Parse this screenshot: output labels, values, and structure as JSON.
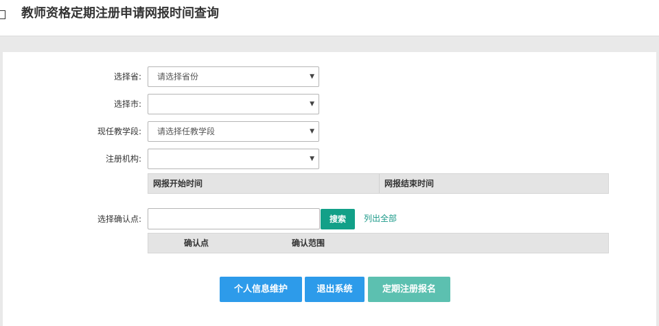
{
  "header": {
    "title": "教师资格定期注册申请网报时间查询"
  },
  "form": {
    "province": {
      "label": "选择省:",
      "value": "请选择省份"
    },
    "city": {
      "label": "选择市:",
      "value": ""
    },
    "stage": {
      "label": "现任教学段:",
      "value": "请选择任教学段"
    },
    "institution": {
      "label": "注册机构:",
      "value": ""
    }
  },
  "schedule_table": {
    "columns": [
      "网报开始时间",
      "网报结束时间"
    ]
  },
  "confirm_point": {
    "label": "选择确认点:",
    "input_value": "",
    "search_label": "搜索",
    "list_all_label": "列出全部"
  },
  "confirm_table": {
    "columns": [
      "",
      "确认点",
      "确认范围"
    ]
  },
  "actions": {
    "profile_label": "个人信息维护",
    "logout_label": "退出系统",
    "register_label": "定期注册报名"
  },
  "colors": {
    "primary_blue": "#2d9bea",
    "teal": "#12a088",
    "teal_light": "#5cc0b0"
  }
}
